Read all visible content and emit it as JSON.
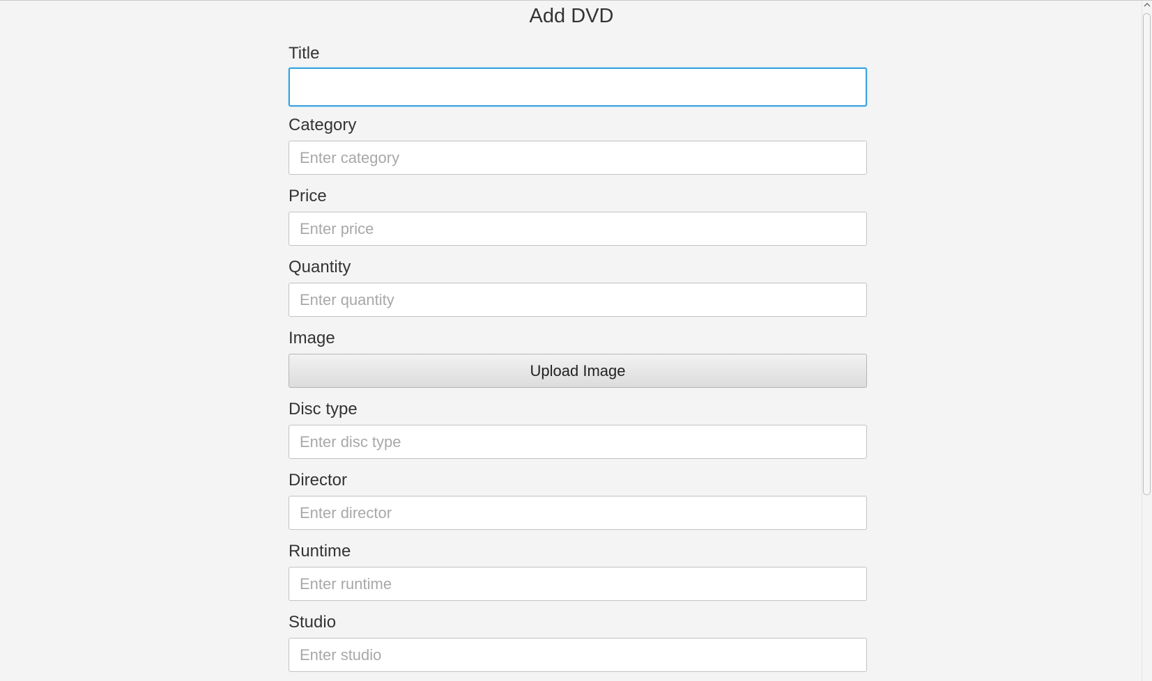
{
  "page": {
    "title": "Add DVD"
  },
  "form": {
    "title": {
      "label": "Title",
      "value": "",
      "placeholder": ""
    },
    "category": {
      "label": "Category",
      "placeholder": "Enter category"
    },
    "price": {
      "label": "Price",
      "placeholder": "Enter price"
    },
    "quantity": {
      "label": "Quantity",
      "placeholder": "Enter quantity"
    },
    "image": {
      "label": "Image",
      "button_label": "Upload Image"
    },
    "disc_type": {
      "label": "Disc type",
      "placeholder": "Enter disc type"
    },
    "director": {
      "label": "Director",
      "placeholder": "Enter director"
    },
    "runtime": {
      "label": "Runtime",
      "placeholder": "Enter runtime"
    },
    "studio": {
      "label": "Studio",
      "placeholder": "Enter studio"
    }
  },
  "scrollbar": {
    "up_arrow_icon": "chevron-up-icon"
  },
  "colors": {
    "background": "#f4f4f4",
    "focus_border": "#3aa4dc",
    "input_border": "#c2c2c2",
    "placeholder": "#a8a8a8"
  }
}
